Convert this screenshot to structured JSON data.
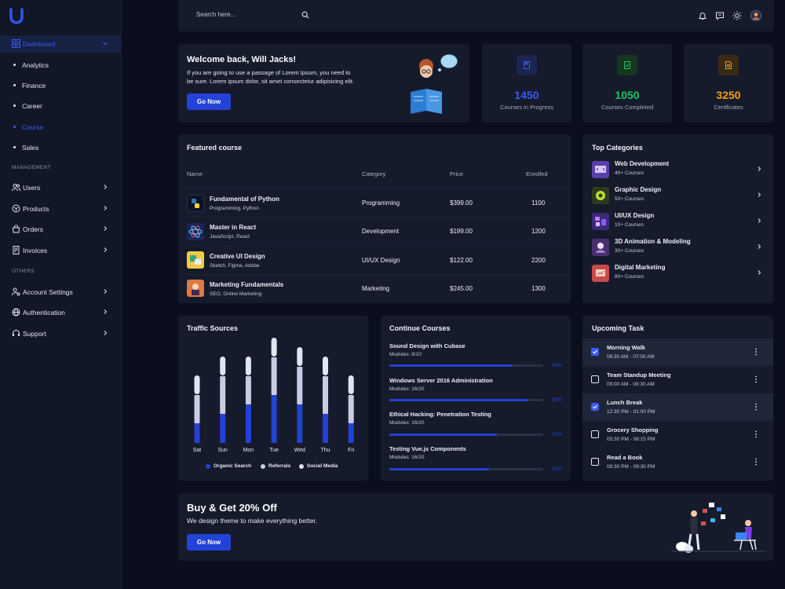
{
  "colors": {
    "accent": "#2342d6",
    "accent_light": "#3b5cf2",
    "bg": "#0b0f1d",
    "card": "#151b2b",
    "green": "#22c55e",
    "orange": "#f59e0b"
  },
  "sidebar": {
    "dashboard": "Dashboard",
    "sub_items": [
      "Analytics",
      "Finance",
      "Career",
      "Course",
      "Sales"
    ],
    "management_label": "MANAGEMENT",
    "management": [
      {
        "label": "Users",
        "icon": "users-icon"
      },
      {
        "label": "Products",
        "icon": "box-icon"
      },
      {
        "label": "Orders",
        "icon": "bag-icon"
      },
      {
        "label": "Invoices",
        "icon": "invoice-icon"
      }
    ],
    "others_label": "OTHERS",
    "others": [
      {
        "label": "Account Settings",
        "icon": "user-gear-icon"
      },
      {
        "label": "Authentication",
        "icon": "globe-icon"
      },
      {
        "label": "Support",
        "icon": "headset-icon"
      }
    ]
  },
  "topbar": {
    "search_placeholder": "Search here...",
    "icons": [
      "bell-icon",
      "chat-icon",
      "sun-icon",
      "avatar"
    ]
  },
  "welcome": {
    "title": "Welcome back, Will Jacks!",
    "text_line1": "If you are going to use a passage of Lorem Ipsum, you need to",
    "text_line2": "be sure. Lorem ipsum dolor, sit amet consectetur adipisicing elit.",
    "button": "Go Now"
  },
  "stats": [
    {
      "value": "1450",
      "label": "Courses in Progress",
      "color": "#3b5cf2"
    },
    {
      "value": "1050",
      "label": "Courses Completed",
      "color": "#22c55e"
    },
    {
      "value": "3250",
      "label": "Certificates",
      "color": "#f59e0b"
    }
  ],
  "featured": {
    "title": "Featured course",
    "headers": [
      "Name",
      "Category",
      "Price",
      "Enrolled"
    ],
    "rows": [
      {
        "name": "Fundamental of Python",
        "tags": "Programming, Python",
        "category": "Programming",
        "price": "$399.00",
        "enrolled": "1100"
      },
      {
        "name": "Master in React",
        "tags": "JavaScript, React",
        "category": "Development",
        "price": "$199.00",
        "enrolled": "1200"
      },
      {
        "name": "Creative UI Design",
        "tags": "Sketch, Figma, Adobe",
        "category": "UI/UX Design",
        "price": "$122.00",
        "enrolled": "2200"
      },
      {
        "name": "Marketing Fundamentals",
        "tags": "SEO, Online Marketing",
        "category": "Marketing",
        "price": "$245.00",
        "enrolled": "1300"
      }
    ]
  },
  "categories": {
    "title": "Top Categories",
    "items": [
      {
        "name": "Web Development",
        "count": "40+ Courses"
      },
      {
        "name": "Graphic Design",
        "count": "50+ Courses"
      },
      {
        "name": "UI/UX Design",
        "count": "10+ Courses"
      },
      {
        "name": "3D Animation & Modeling",
        "count": "30+ Courses"
      },
      {
        "name": "Digital Marketing",
        "count": "80+ Courses"
      }
    ]
  },
  "traffic": {
    "title": "Traffic Sources",
    "legend": [
      "Organic Search",
      "Referrals",
      "Social Media"
    ]
  },
  "chart_data": {
    "type": "bar",
    "stacked": true,
    "categories": [
      "Sat",
      "Sun",
      "Mon",
      "Tue",
      "Wed",
      "Thu",
      "Fri"
    ],
    "series": [
      {
        "name": "Organic Search",
        "values": [
          25,
          37,
          49,
          61,
          49,
          37,
          25
        ],
        "color": "#2342d6"
      },
      {
        "name": "Referrals",
        "values": [
          37,
          49,
          37,
          49,
          49,
          49,
          37
        ],
        "color": "#c9cde3"
      },
      {
        "name": "Social Media",
        "values": [
          25,
          25,
          25,
          25,
          25,
          25,
          25
        ],
        "color": "#e2e4ef"
      }
    ]
  },
  "continue": {
    "title": "Continue Courses",
    "items": [
      {
        "title": "Sound Design with Cubase",
        "modules": "Modules: 8/10",
        "percent": "80%",
        "progress": 0.8
      },
      {
        "title": "Windows Server 2016 Administration",
        "modules": "Modules: 16/20",
        "percent": "90%",
        "progress": 0.9
      },
      {
        "title": "Ethical Hacking: Penetration Testing",
        "modules": "Modules: 16/20",
        "percent": "70%",
        "progress": 0.7
      },
      {
        "title": "Testing Vue.js Components",
        "modules": "Modules: 16/20",
        "percent": "65%",
        "progress": 0.65
      }
    ]
  },
  "tasks": {
    "title": "Upcoming Task",
    "items": [
      {
        "title": "Morning Walk",
        "time": "06:30 AM - 07:00 AM",
        "checked": true
      },
      {
        "title": "Team Standup Meeting",
        "time": "09:00 AM - 09:30 AM",
        "checked": false
      },
      {
        "title": "Lunch Break",
        "time": "12:30 PM - 01:00 PM",
        "checked": true
      },
      {
        "title": "Grocery Shopping",
        "time": "05:30 PM - 06:15 PM",
        "checked": false
      },
      {
        "title": "Read a Book",
        "time": "08:30 PM - 09:30 PM",
        "checked": false
      }
    ]
  },
  "promo": {
    "title": "Buy & Get 20% Off",
    "subtitle": "We design theme to make everything better.",
    "button": "Go Now"
  }
}
